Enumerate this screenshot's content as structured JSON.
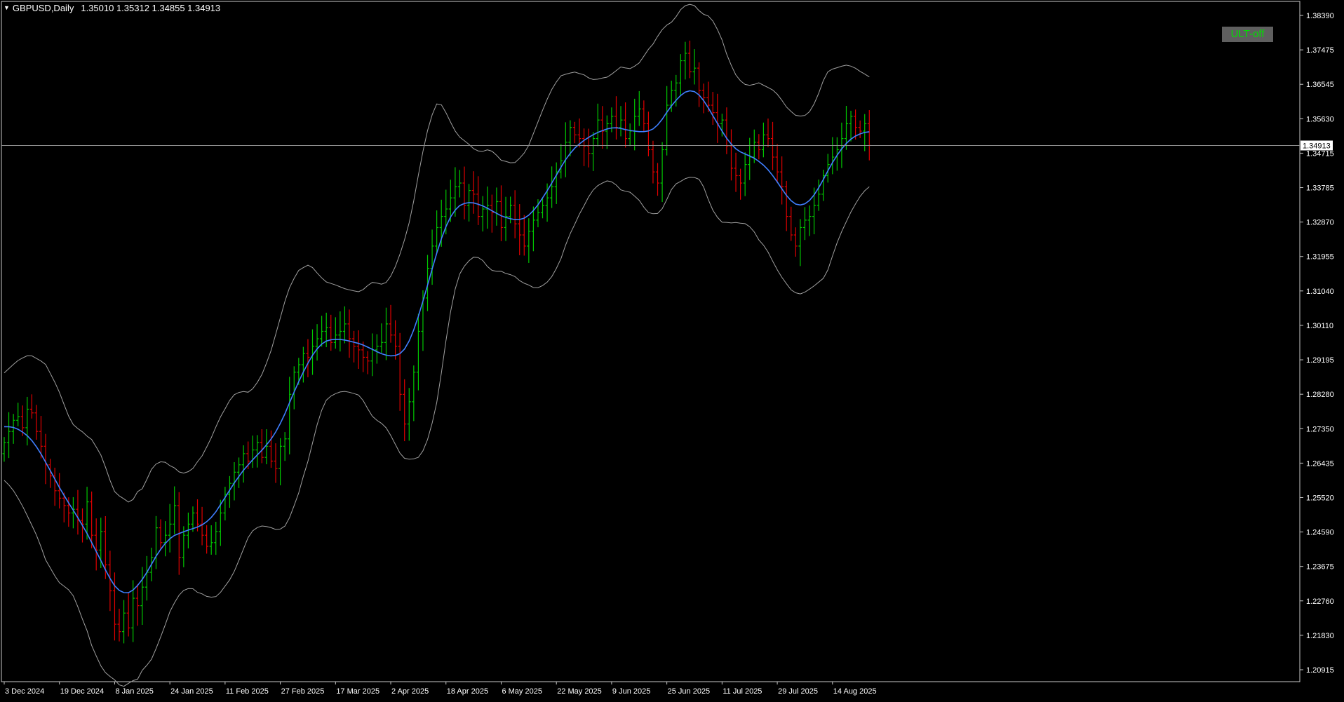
{
  "title": {
    "symbol_timeframe": "GBPUSD,Daily",
    "ohlc": "1.35010 1.35312 1.34855 1.34913"
  },
  "ult_button": {
    "label": "ULT-off"
  },
  "current_price": {
    "label": "1.34913",
    "value": 1.34913
  },
  "colors": {
    "background": "#000000",
    "frame": "#c8c8c8",
    "bull_bar": "#00c800",
    "bear_bar": "#e00000",
    "midline": "#3f7fff",
    "bands": "#a0a0a0",
    "price_line": "#909090",
    "button_bg": "#5f5f5f",
    "button_text": "#00e000"
  },
  "chart_data": {
    "type": "ohlc",
    "ylim": [
      1.2045,
      1.388
    ],
    "y_ticks": [
      "1.38390",
      "1.37475",
      "1.36545",
      "1.35630",
      "1.34715",
      "1.33785",
      "1.32870",
      "1.31955",
      "1.31040",
      "1.30110",
      "1.29195",
      "1.28280",
      "1.27350",
      "1.26435",
      "1.25520",
      "1.24590",
      "1.23675",
      "1.22760",
      "1.21830",
      "1.20915"
    ],
    "x_ticks": [
      {
        "label": "3 Dec 2024",
        "index": 0
      },
      {
        "label": "19 Dec 2024",
        "index": 12
      },
      {
        "label": "8 Jan 2025",
        "index": 24
      },
      {
        "label": "24 Jan 2025",
        "index": 36
      },
      {
        "label": "11 Feb 2025",
        "index": 48
      },
      {
        "label": "27 Feb 2025",
        "index": 60
      },
      {
        "label": "17 Mar 2025",
        "index": 72
      },
      {
        "label": "2 Apr 2025",
        "index": 84
      },
      {
        "label": "18 Apr 2025",
        "index": 96
      },
      {
        "label": "6 May 2025",
        "index": 108
      },
      {
        "label": "22 May 2025",
        "index": 120
      },
      {
        "label": "9 Jun 2025",
        "index": 132
      },
      {
        "label": "25 Jun 2025",
        "index": 144
      },
      {
        "label": "11 Jul 2025",
        "index": 156
      },
      {
        "label": "29 Jul 2025",
        "index": 168
      },
      {
        "label": "14 Aug 2025",
        "index": 180
      }
    ],
    "closes": [
      1.269,
      1.272,
      1.275,
      1.276,
      1.273,
      1.278,
      1.277,
      1.272,
      1.268,
      1.263,
      1.26,
      1.256,
      1.254,
      1.252,
      1.25,
      1.251,
      1.248,
      1.247,
      1.253,
      1.244,
      1.24,
      1.245,
      1.236,
      1.229,
      1.22,
      1.218,
      1.223,
      1.219,
      1.227,
      1.225,
      1.23,
      1.234,
      1.238,
      1.246,
      1.242,
      1.244,
      1.247,
      1.252,
      1.238,
      1.244,
      1.247,
      1.25,
      1.247,
      1.244,
      1.241,
      1.242,
      1.245,
      1.25,
      1.255,
      1.258,
      1.261,
      1.263,
      1.266,
      1.264,
      1.267,
      1.269,
      1.265,
      1.268,
      1.264,
      1.262,
      1.268,
      1.27,
      1.282,
      1.288,
      1.29,
      1.293,
      1.292,
      1.295,
      1.297,
      1.299,
      1.3,
      1.296,
      1.298,
      1.299,
      1.301,
      1.297,
      1.295,
      1.294,
      1.292,
      1.291,
      1.294,
      1.295,
      1.296,
      1.301,
      1.298,
      1.295,
      1.282,
      1.274,
      1.28,
      1.288,
      1.299,
      1.308,
      1.316,
      1.322,
      1.327,
      1.33,
      1.332,
      1.335,
      1.338,
      1.339,
      1.333,
      1.337,
      1.336,
      1.33,
      1.332,
      1.333,
      1.331,
      1.334,
      1.327,
      1.33,
      1.333,
      1.328,
      1.325,
      1.322,
      1.326,
      1.329,
      1.331,
      1.333,
      1.335,
      1.338,
      1.342,
      1.345,
      1.35,
      1.354,
      1.352,
      1.351,
      1.349,
      1.347,
      1.351,
      1.356,
      1.353,
      1.355,
      1.357,
      1.354,
      1.356,
      1.351,
      1.353,
      1.357,
      1.359,
      1.355,
      1.348,
      1.342,
      1.339,
      1.348,
      1.36,
      1.364,
      1.366,
      1.372,
      1.374,
      1.369,
      1.37,
      1.364,
      1.362,
      1.36,
      1.358,
      1.355,
      1.356,
      1.349,
      1.343,
      1.341,
      1.339,
      1.344,
      1.346,
      1.35,
      1.348,
      1.352,
      1.351,
      1.346,
      1.342,
      1.338,
      1.33,
      1.325,
      1.322,
      1.327,
      1.329,
      1.33,
      1.333,
      1.336,
      1.341,
      1.344,
      1.346,
      1.348,
      1.351,
      1.355,
      1.357,
      1.354,
      1.353,
      1.355,
      1.34913
    ]
  }
}
